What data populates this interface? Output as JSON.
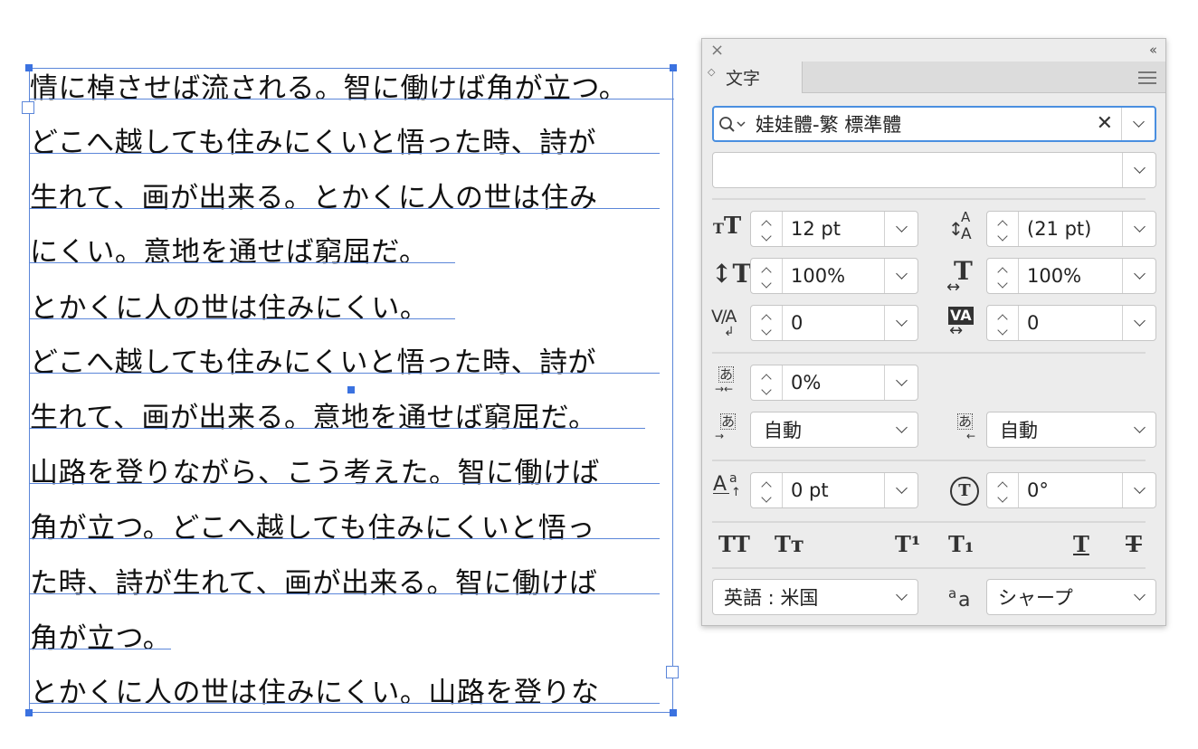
{
  "document": {
    "lines": [
      "情に棹させば流される。智に働けば角が立つ。",
      "どこへ越しても住みにくいと悟った時、詩が",
      "生れて、画が出来る。とかくに人の世は住み",
      "にくい。意地を通せば窮屈だ。",
      "とかくに人の世は住みにくい。",
      "どこへ越しても住みにくいと悟った時、詩が",
      "生れて、画が出来る。意地を通せば窮屈だ。",
      "山路を登りながら、こう考えた。智に働けば",
      "角が立つ。どこへ越しても住みにくいと悟っ",
      "た時、詩が生れて、画が出来る。智に働けば",
      "角が立つ。",
      "とかくに人の世は住みにくい。山路を登りな"
    ]
  },
  "panel": {
    "close_icon": "×",
    "collapse_icon": "‹‹",
    "tab_arrows": "◇",
    "tab_label": "文字",
    "font_family": "娃娃體-繁 標準體",
    "font_clear": "✕",
    "font_style": "",
    "font_size": "12 pt",
    "leading": "(21 pt)",
    "vertical_scale": "100%",
    "horizontal_scale": "100%",
    "kerning": "0",
    "tracking": "0",
    "tsume": "0%",
    "aki_left": "自動",
    "aki_right": "自動",
    "baseline_shift": "0 pt",
    "rotation": "0°",
    "language": "英語 : 米国",
    "anti_alias": "シャープ",
    "btn_all_caps": "TT",
    "btn_small_caps": "Tт",
    "btn_superscript": "T¹",
    "btn_subscript": "T₁",
    "btn_underline": "T",
    "btn_strikethrough": "T",
    "icon_leading_top": "A",
    "icon_leading_bottom": "A",
    "icon_kerning": "V/A",
    "icon_tracking": "VA",
    "icon_tsume": "あ",
    "icon_aki_left": "あ",
    "icon_aki_right": "あ",
    "icon_baseline_big": "A",
    "icon_baseline_small": "a",
    "icon_rotation": "T",
    "icon_aa_small": "a",
    "icon_aa_big": "a"
  },
  "colors": {
    "selection_blue": "#3b72e0",
    "focus_blue": "#4a8fe0",
    "panel_bg": "#ececec"
  }
}
